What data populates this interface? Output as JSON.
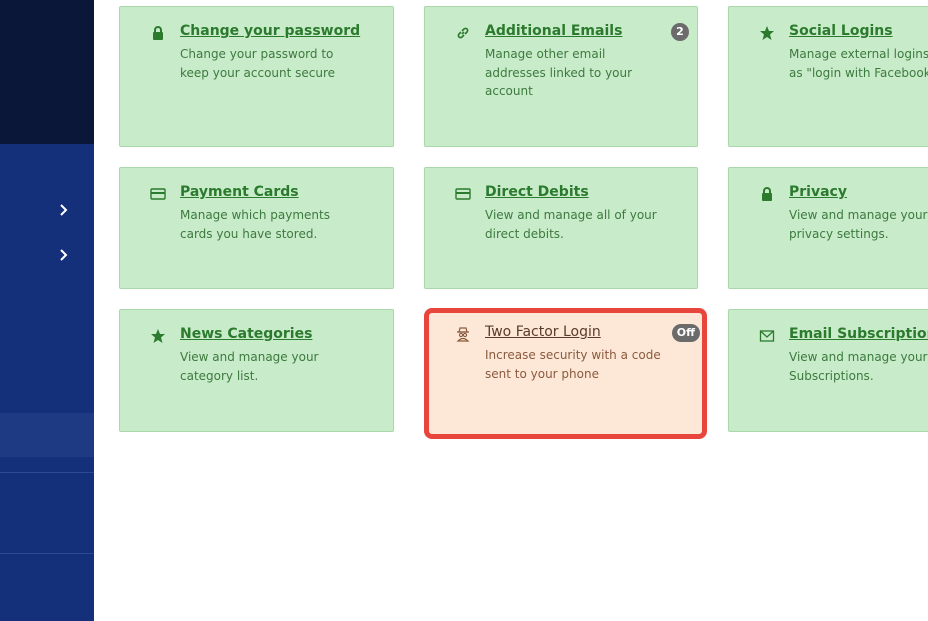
{
  "colors": {
    "sidebar_bg": "#15307a",
    "sidebar_top": "#0b1739",
    "card_bg": "#c8ebc9",
    "card_title": "#2b7a2e",
    "warn_bg": "#fde8d8",
    "warn_border": "#e8453c",
    "badge_bg": "#6b6b6b"
  },
  "sidebar": {
    "items": [
      {
        "icon": "chevron-right-icon"
      },
      {
        "icon": "chevron-right-icon"
      }
    ]
  },
  "cards": [
    {
      "title": "Change your password",
      "desc": "Change your password to keep your account secure",
      "icon": "lock-icon"
    },
    {
      "title": "Additional Emails",
      "desc": "Manage other email addresses linked to your account",
      "icon": "link-icon",
      "badge": "2"
    },
    {
      "title": "Social Logins",
      "desc": "Manage external logins such as \"login with Facebook\"",
      "icon": "star-icon"
    },
    {
      "title": "Payment Cards",
      "desc": "Manage which payments cards you have stored.",
      "icon": "credit-card-icon"
    },
    {
      "title": "Direct Debits",
      "desc": "View and manage all of your direct debits.",
      "icon": "credit-card-icon"
    },
    {
      "title": "Privacy",
      "desc": "View and manage your privacy settings.",
      "icon": "lock-icon"
    },
    {
      "title": "News Categories",
      "desc": "View and manage your category list.",
      "icon": "star-icon"
    },
    {
      "title": "Two Factor Login",
      "desc": "Increase security with a code sent to your phone",
      "icon": "spy-icon",
      "badge": "Off"
    },
    {
      "title": "Email Subscriptions",
      "desc": "View and manage your Email Subscriptions.",
      "icon": "envelope-icon"
    }
  ]
}
